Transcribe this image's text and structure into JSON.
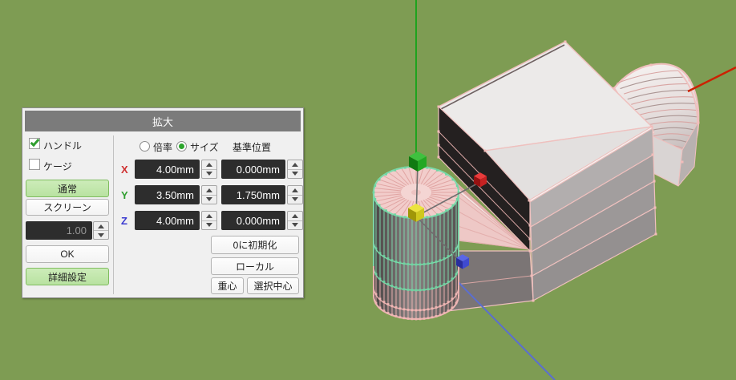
{
  "dialog": {
    "title": "拡大",
    "checkboxes": [
      {
        "label": "ハンドル",
        "checked": true
      },
      {
        "label": "ケージ",
        "checked": false
      }
    ],
    "mode_buttons": [
      {
        "label": "通常",
        "active": true
      },
      {
        "label": "スクリーン",
        "active": false
      }
    ],
    "scale_input": {
      "value": "1.00",
      "disabled": true
    },
    "ok_label": "OK",
    "advanced_label": "詳細設定",
    "advanced_active": true,
    "radio_options": [
      {
        "label": "倍率",
        "selected": false
      },
      {
        "label": "サイズ",
        "selected": true
      }
    ],
    "base_position_label": "基準位置",
    "rows": [
      {
        "axis": "X",
        "color": "#cf2f2f",
        "size": "4.00mm",
        "base": "0.000mm"
      },
      {
        "axis": "Y",
        "color": "#2f9e2f",
        "size": "3.50mm",
        "base": "1.750mm"
      },
      {
        "axis": "Z",
        "color": "#3b3bd0",
        "size": "4.00mm",
        "base": "0.000mm"
      }
    ],
    "action_buttons": {
      "init_zero": "0に初期化",
      "local": "ローカル",
      "centroid": "重心",
      "selection_center": "選択中心"
    }
  },
  "viewport": {
    "background": "#7e9c53",
    "wireframe_color": "#efc0be",
    "selection_color": "#7edbad",
    "axes": {
      "x_color": "#cc2100",
      "y_color": "#1ea31e",
      "z_color": "#5b6ed0"
    },
    "handles": [
      {
        "name": "y-axis-handle",
        "top": "#3fc13f",
        "left": "#117a11",
        "right": "#23a823"
      },
      {
        "name": "center-handle",
        "top": "#ece43e",
        "left": "#a09708",
        "right": "#cfc81e"
      },
      {
        "name": "x-axis-handle",
        "top": "#e83b3b",
        "left": "#971111",
        "right": "#c62222"
      },
      {
        "name": "z-axis-handle",
        "top": "#5a66e6",
        "left": "#292e9c",
        "right": "#3f4ad0"
      }
    ]
  }
}
